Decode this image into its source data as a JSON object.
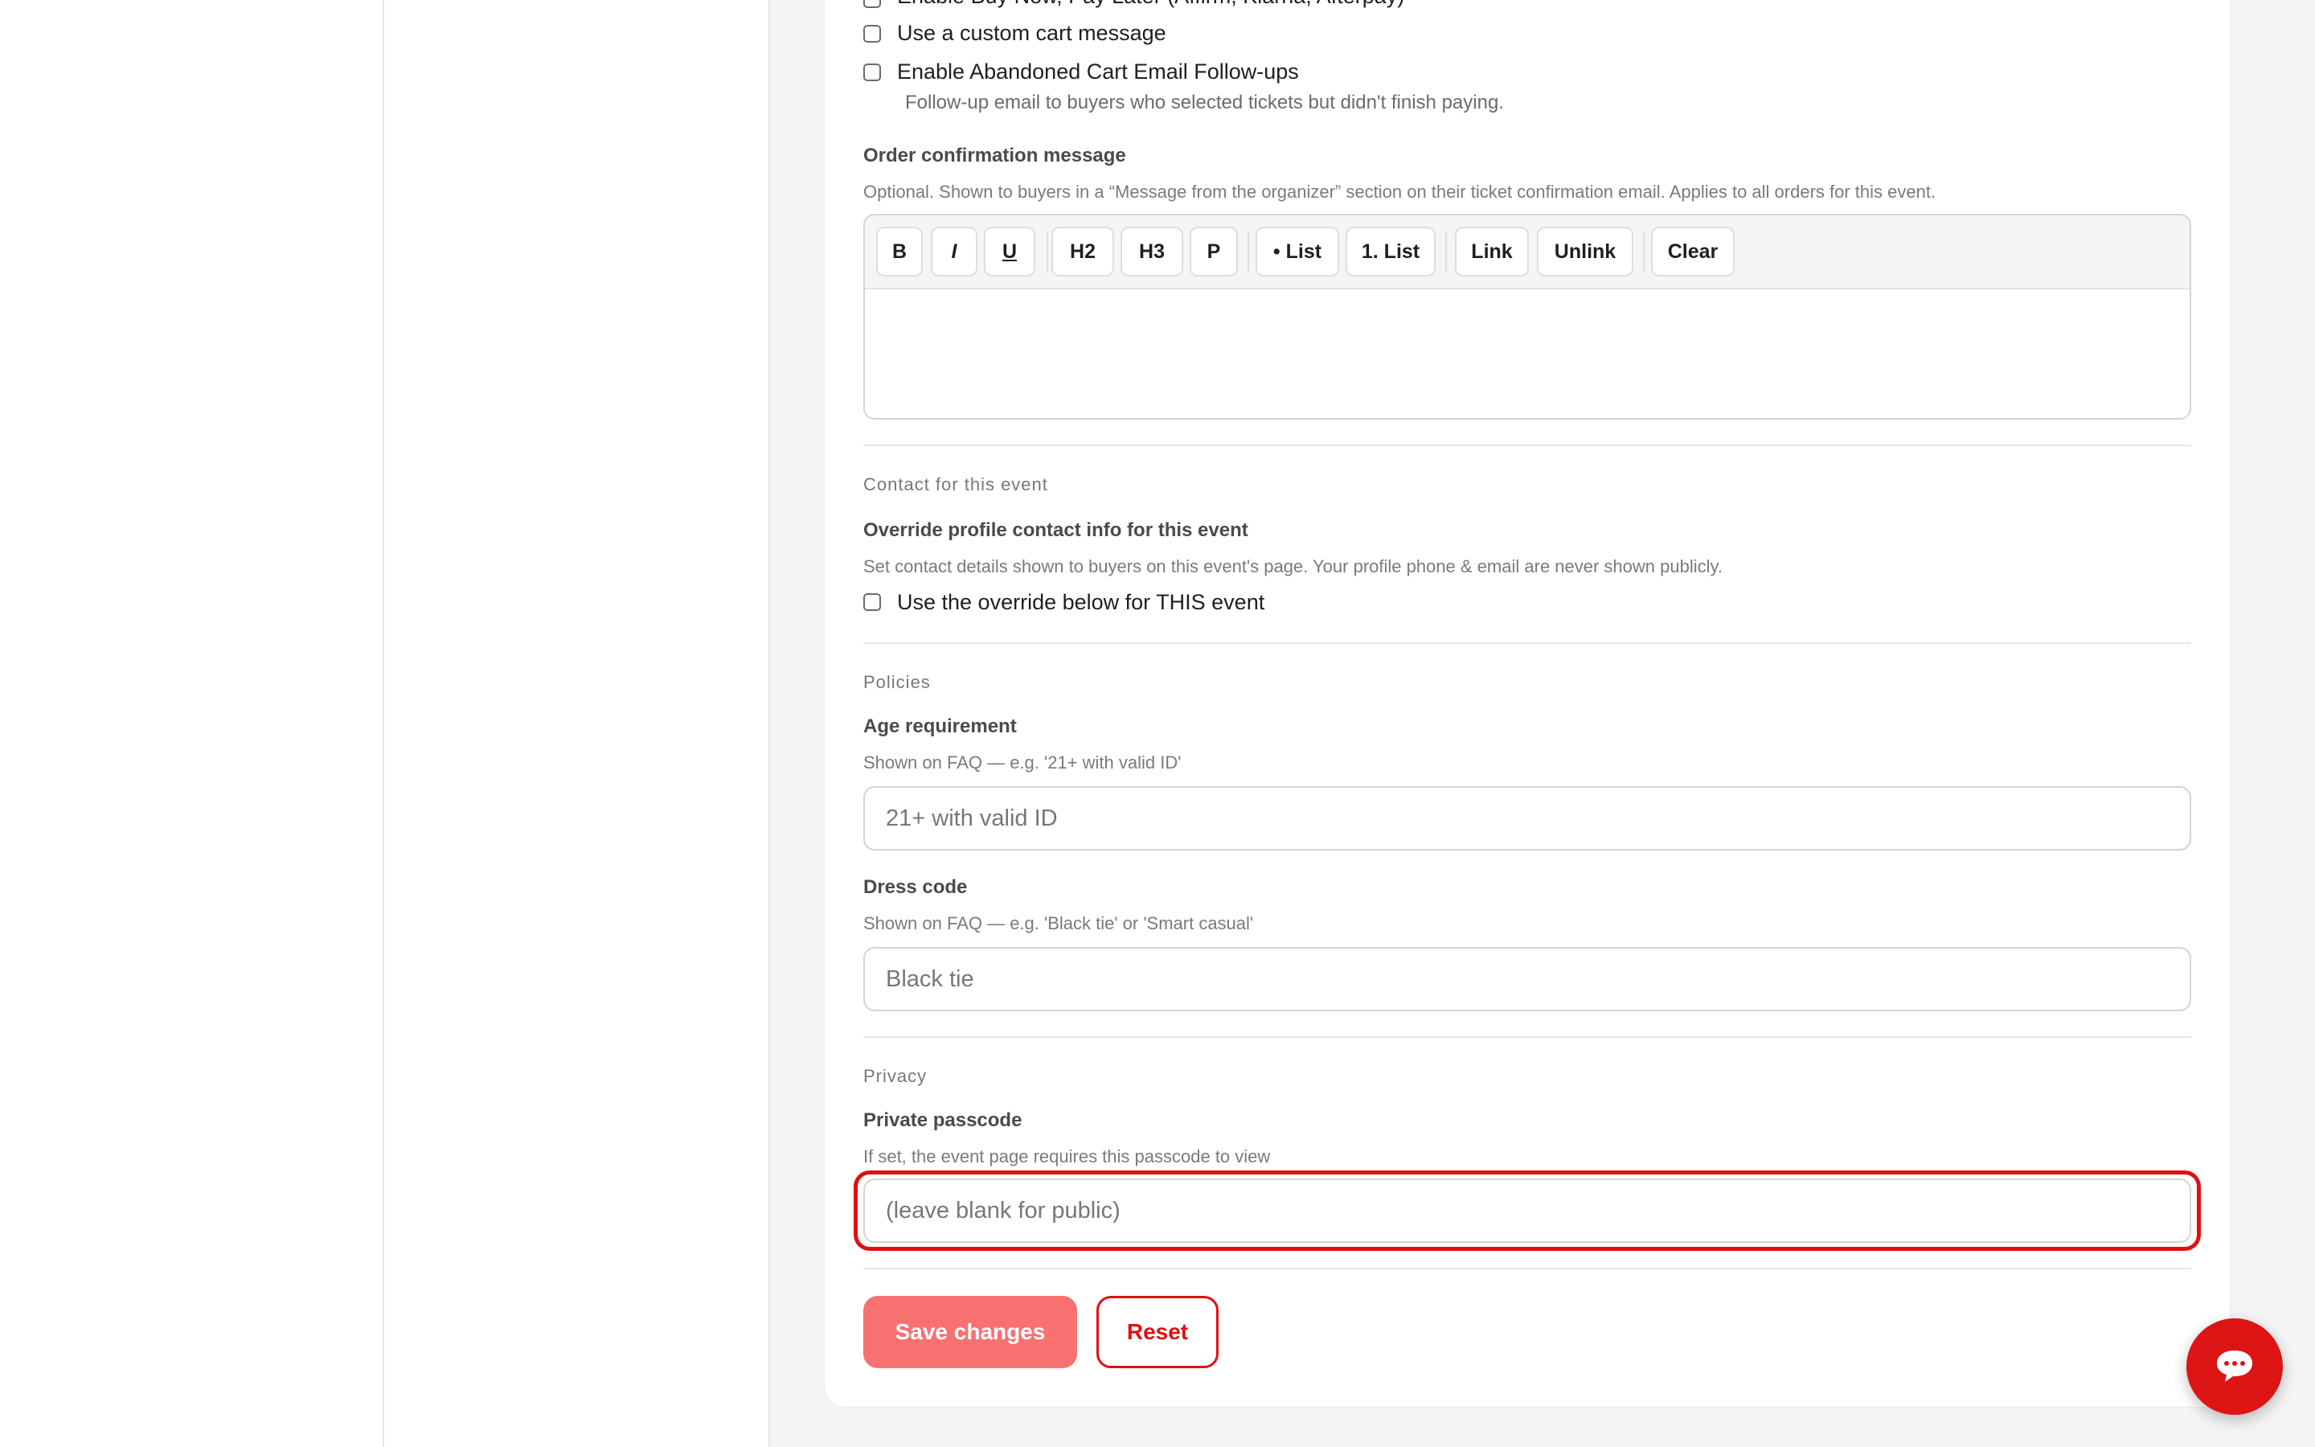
{
  "checkout_options": {
    "bnpl_label": "Enable Buy Now, Pay Later (Affirm, Klarna, Afterpay)",
    "custom_cart_label": "Use a custom cart message",
    "abandoned_cart_label": "Enable Abandoned Cart Email Follow-ups",
    "abandoned_cart_help": "Follow-up email to buyers who selected tickets but didn't finish paying."
  },
  "order_confirmation": {
    "label": "Order confirmation message",
    "help": "Optional. Shown to buyers in a “Message from the organizer” section on their ticket confirmation email. Applies to all orders for this event.",
    "toolbar": {
      "bold": "B",
      "italic": "I",
      "underline": "U",
      "h2": "H2",
      "h3": "H3",
      "p": "P",
      "bullet_list": "• List",
      "numbered_list": "1. List",
      "link": "Link",
      "unlink": "Unlink",
      "clear": "Clear"
    },
    "content": ""
  },
  "contact": {
    "section_title": "Contact for this event",
    "label": "Override profile contact info for this event",
    "help": "Set contact details shown to buyers on this event's page. Your profile phone & email are never shown publicly.",
    "checkbox_label": "Use the override below for THIS event"
  },
  "policies": {
    "section_title": "Policies",
    "age": {
      "label": "Age requirement",
      "help": "Shown on FAQ — e.g. '21+ with valid ID'",
      "placeholder": "21+ with valid ID",
      "value": ""
    },
    "dress": {
      "label": "Dress code",
      "help": "Shown on FAQ — e.g. 'Black tie' or 'Smart casual'",
      "placeholder": "Black tie",
      "value": ""
    }
  },
  "privacy": {
    "section_title": "Privacy",
    "label": "Private passcode",
    "help": "If set, the event page requires this passcode to view",
    "placeholder": "(leave blank for public)",
    "value": ""
  },
  "actions": {
    "save_label": "Save changes",
    "reset_label": "Reset"
  },
  "chat": {
    "icon": "chat-bubble-icon"
  },
  "colors": {
    "accent": "#dc1414",
    "save_button": "#f87171",
    "highlight_outline": "#e01010"
  }
}
